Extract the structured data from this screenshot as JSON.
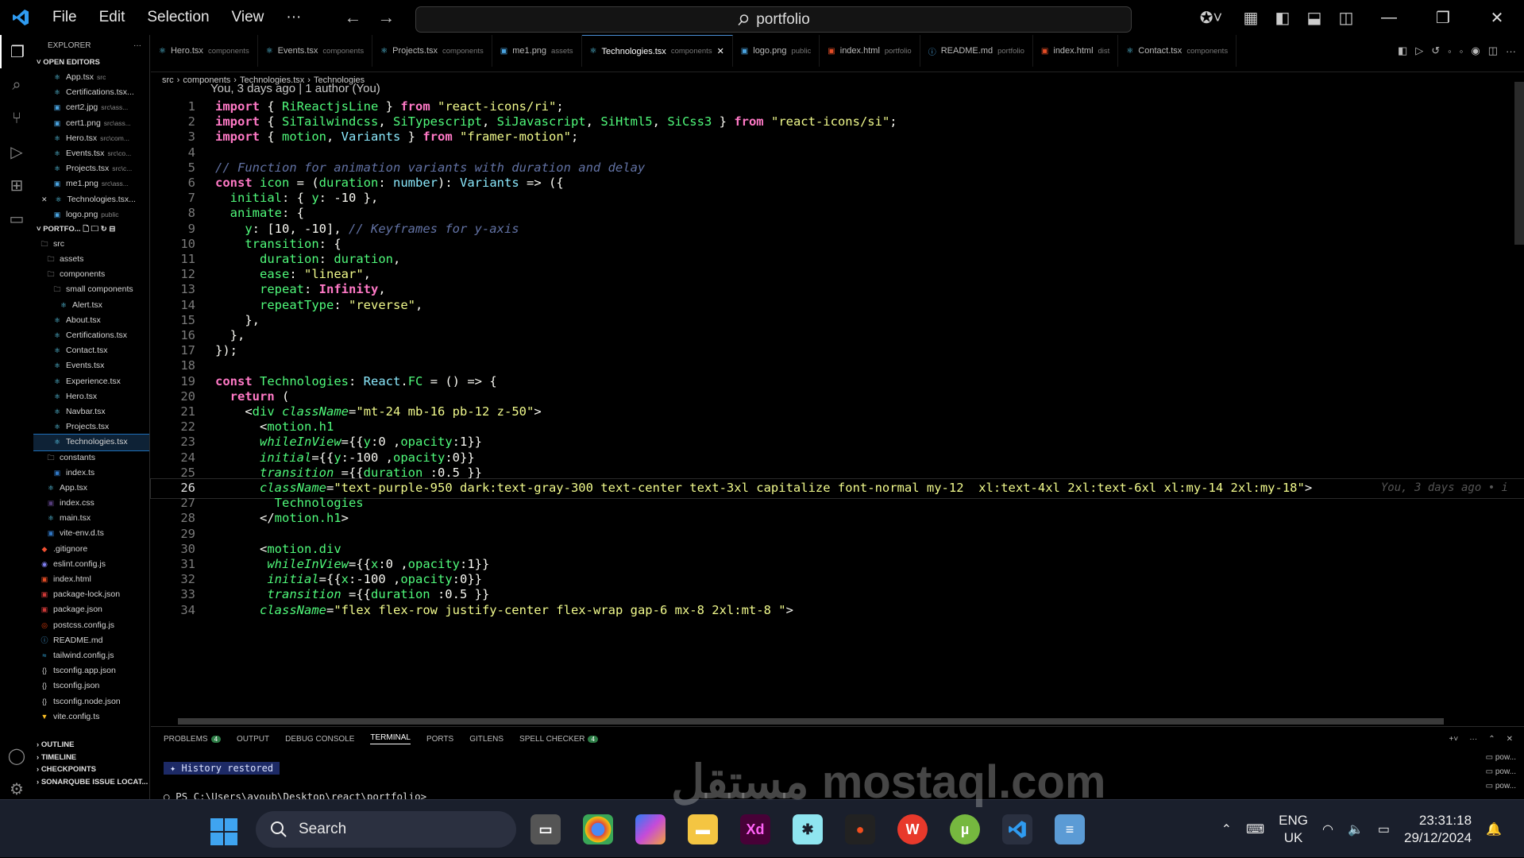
{
  "titlebar": {
    "menu": [
      "File",
      "Edit",
      "Selection",
      "View",
      "···"
    ],
    "search": "portfolio"
  },
  "explorer": {
    "title": "EXPLORER",
    "open_editors_label": "OPEN EDITORS",
    "open_editors": [
      {
        "name": "App.tsx",
        "path": "src"
      },
      {
        "name": "Certifications.tsx...",
        "path": ""
      },
      {
        "name": "cert2.jpg",
        "path": "src\\ass..."
      },
      {
        "name": "cert1.png",
        "path": "src\\ass..."
      },
      {
        "name": "Hero.tsx",
        "path": "src\\com..."
      },
      {
        "name": "Events.tsx",
        "path": "src\\co..."
      },
      {
        "name": "Projects.tsx",
        "path": "src\\c..."
      },
      {
        "name": "me1.png",
        "path": "src\\ass..."
      },
      {
        "name": "Technologies.tsx...",
        "path": ""
      },
      {
        "name": "logo.png",
        "path": "public"
      }
    ],
    "project_label": "PORTFO...",
    "tree": [
      {
        "name": "src",
        "indent": 1,
        "kind": "folder"
      },
      {
        "name": "assets",
        "indent": 2,
        "kind": "folder"
      },
      {
        "name": "components",
        "indent": 2,
        "kind": "folder"
      },
      {
        "name": "small components",
        "indent": 3,
        "kind": "folder"
      },
      {
        "name": "Alert.tsx",
        "indent": 4,
        "kind": "react"
      },
      {
        "name": "About.tsx",
        "indent": 3,
        "kind": "react"
      },
      {
        "name": "Certifications.tsx",
        "indent": 3,
        "kind": "react"
      },
      {
        "name": "Contact.tsx",
        "indent": 3,
        "kind": "react"
      },
      {
        "name": "Events.tsx",
        "indent": 3,
        "kind": "react"
      },
      {
        "name": "Experience.tsx",
        "indent": 3,
        "kind": "react"
      },
      {
        "name": "Hero.tsx",
        "indent": 3,
        "kind": "react"
      },
      {
        "name": "Navbar.tsx",
        "indent": 3,
        "kind": "react"
      },
      {
        "name": "Projects.tsx",
        "indent": 3,
        "kind": "react"
      },
      {
        "name": "Technologies.tsx",
        "indent": 3,
        "kind": "react"
      },
      {
        "name": "constants",
        "indent": 2,
        "kind": "folder"
      },
      {
        "name": "index.ts",
        "indent": 3,
        "kind": "ts"
      },
      {
        "name": "App.tsx",
        "indent": 2,
        "kind": "react"
      },
      {
        "name": "index.css",
        "indent": 2,
        "kind": "css"
      },
      {
        "name": "main.tsx",
        "indent": 2,
        "kind": "react"
      },
      {
        "name": "vite-env.d.ts",
        "indent": 2,
        "kind": "ts"
      },
      {
        "name": ".gitignore",
        "indent": 1,
        "kind": "git"
      },
      {
        "name": "eslint.config.js",
        "indent": 1,
        "kind": "eslint"
      },
      {
        "name": "index.html",
        "indent": 1,
        "kind": "html"
      },
      {
        "name": "package-lock.json",
        "indent": 1,
        "kind": "npm"
      },
      {
        "name": "package.json",
        "indent": 1,
        "kind": "npm"
      },
      {
        "name": "postcss.config.js",
        "indent": 1,
        "kind": "postcss"
      },
      {
        "name": "README.md",
        "indent": 1,
        "kind": "info"
      },
      {
        "name": "tailwind.config.js",
        "indent": 1,
        "kind": "tailwind"
      },
      {
        "name": "tsconfig.app.json",
        "indent": 1,
        "kind": "json"
      },
      {
        "name": "tsconfig.json",
        "indent": 1,
        "kind": "json"
      },
      {
        "name": "tsconfig.node.json",
        "indent": 1,
        "kind": "json"
      },
      {
        "name": "vite.config.ts",
        "indent": 1,
        "kind": "vite"
      }
    ],
    "bottom_sections": [
      "OUTLINE",
      "TIMELINE",
      "CHECKPOINTS",
      "SONARQUBE ISSUE LOCAT..."
    ]
  },
  "tabs": [
    {
      "name": "Hero.tsx",
      "sub": "components"
    },
    {
      "name": "Events.tsx",
      "sub": "components"
    },
    {
      "name": "Projects.tsx",
      "sub": "components"
    },
    {
      "name": "me1.png",
      "sub": "assets"
    },
    {
      "name": "Technologies.tsx",
      "sub": "components",
      "active": true
    },
    {
      "name": "logo.png",
      "sub": "public"
    },
    {
      "name": "index.html",
      "sub": "portfolio"
    },
    {
      "name": "README.md",
      "sub": "portfolio"
    },
    {
      "name": "index.html",
      "sub": "dist"
    },
    {
      "name": "Contact.tsx",
      "sub": "components"
    }
  ],
  "breadcrumb": [
    "src",
    "components",
    "Technologies.tsx",
    "Technologies"
  ],
  "blame": {
    "top": "You, 3 days ago | 1 author (You)",
    "inline": "You, 3 days ago • i"
  },
  "current_line": 26,
  "code": [
    "import { RiReactjsLine } from \"react-icons/ri\";",
    "import { SiTailwindcss, SiTypescript, SiJavascript, SiHtml5, SiCss3 } from \"react-icons/si\";",
    "import { motion, Variants } from \"framer-motion\";",
    "",
    "// Function for animation variants with duration and delay",
    "const icon = (duration: number): Variants => ({",
    "  initial: { y: -10 },",
    "  animate: {",
    "    y: [10, -10], // Keyframes for y-axis",
    "    transition: {",
    "      duration: duration,",
    "      ease: \"linear\",",
    "      repeat: Infinity,",
    "      repeatType: \"reverse\",",
    "    },",
    "  },",
    "});",
    "",
    "const Technologies: React.FC = () => {",
    "  return (",
    "    <div className=\"mt-24 mb-16 pb-12 z-50\">",
    "      <motion.h1",
    "      whileInView={{y:0 ,opacity:1}}",
    "      initial={{y:-100 ,opacity:0}}",
    "      transition ={{duration :0.5 }}",
    "      className=\"text-purple-950 dark:text-gray-300 text-center text-3xl capitalize font-normal my-12  xl:text-4xl 2xl:text-6xl xl:my-14 2xl:my-18\">",
    "        Technologies",
    "      </motion.h1>",
    "",
    "      <motion.div",
    "       whileInView={{x:0 ,opacity:1}}",
    "       initial={{x:-100 ,opacity:0}}",
    "       transition ={{duration :0.5 }}",
    "      className=\"flex flex-row justify-center flex-wrap gap-6 mx-8 2xl:mt-8 \">"
  ],
  "panel": {
    "tabs": [
      {
        "name": "PROBLEMS",
        "badge": "4"
      },
      {
        "name": "OUTPUT"
      },
      {
        "name": "DEBUG CONSOLE"
      },
      {
        "name": "TERMINAL",
        "active": true
      },
      {
        "name": "PORTS"
      },
      {
        "name": "GITLENS"
      },
      {
        "name": "SPELL CHECKER",
        "badge": "4"
      }
    ],
    "history": "History restored",
    "prompt": "PS C:\\Users\\ayoub\\Desktop\\react\\portfolio>",
    "terminals": [
      "pow...",
      "pow...",
      "pow..."
    ]
  },
  "taskbar": {
    "search": "Search",
    "lang": [
      "ENG",
      "UK"
    ],
    "time": "23:31:18",
    "date": "29/12/2024",
    "watermark": "مستقل mostaql.com"
  },
  "colors": {
    "keyword": "#ff79c6",
    "function": "#50fa7b",
    "string": "#f1fa8c",
    "comment": "#6272a4",
    "accent": "#2f9bf0"
  }
}
